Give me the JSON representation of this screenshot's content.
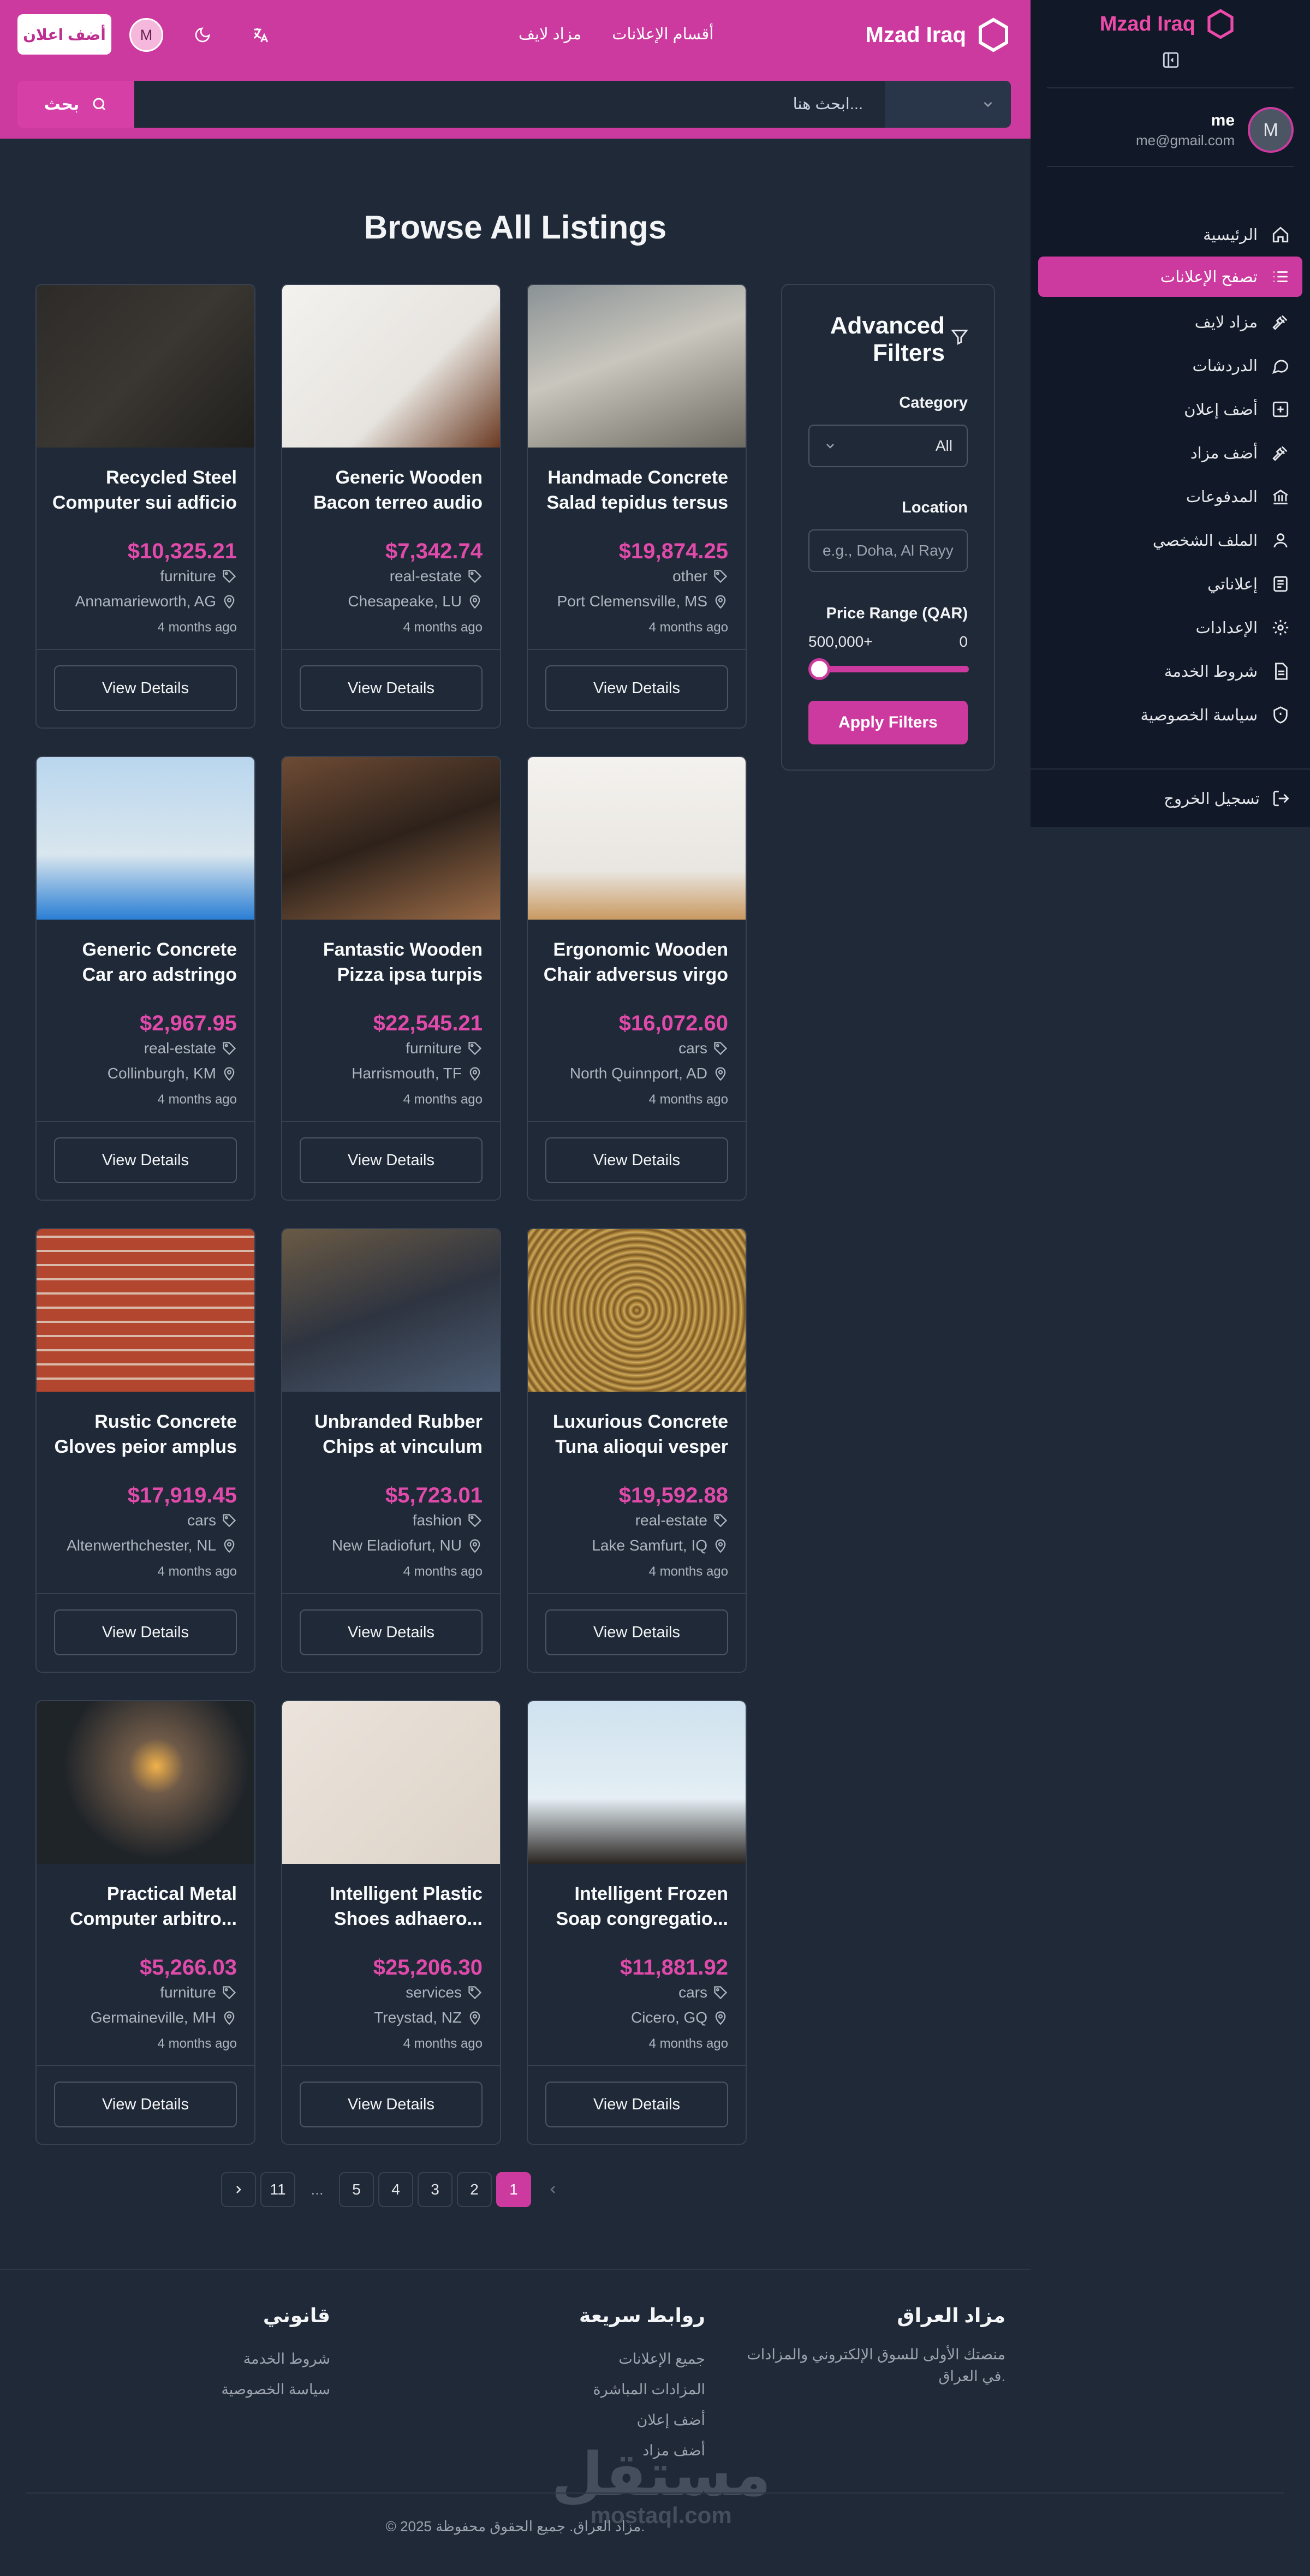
{
  "header": {
    "brand": "Mzad Iraq",
    "nav": [
      "أقسام الإعلانات",
      "مزاد لايف"
    ],
    "avatar_initial": "M",
    "add_button": "أضف اعلان"
  },
  "search": {
    "button_label": "بحث",
    "placeholder": "ابحث هنا...",
    "category_selected": ""
  },
  "sidebar": {
    "brand": "Mzad Iraq",
    "user": {
      "name": "me",
      "email": "me@gmail.com",
      "initial": "M"
    },
    "items": [
      {
        "label": "الرئيسية",
        "icon": "home-icon"
      },
      {
        "label": "تصفح الإعلانات",
        "icon": "list-icon",
        "active": true
      },
      {
        "label": "مزاد لايف",
        "icon": "gavel-icon"
      },
      {
        "label": "الدردشات",
        "icon": "chat-icon"
      },
      {
        "label": "أضف إعلان",
        "icon": "plus-square-icon"
      },
      {
        "label": "أضف مزاد",
        "icon": "gavel-icon"
      },
      {
        "label": "المدفوعات",
        "icon": "bank-icon"
      },
      {
        "label": "الملف الشخصي",
        "icon": "user-icon"
      },
      {
        "label": "إعلاناتي",
        "icon": "document-icon"
      },
      {
        "label": "الإعدادات",
        "icon": "gear-icon"
      },
      {
        "label": "شروط الخدمة",
        "icon": "file-text-icon"
      },
      {
        "label": "سياسة الخصوصية",
        "icon": "shield-icon"
      }
    ],
    "logout": "تسجيل الخروج"
  },
  "main": {
    "title": "Browse All Listings"
  },
  "listings": [
    {
      "title": "Handmade Concrete Salad tepidus tersus",
      "price": "$19,874.25",
      "category": "other",
      "location": "Port Clemensville, MS",
      "time": "4 months ago",
      "button": "View Details"
    },
    {
      "title": "Generic Wooden Bacon terreo audio",
      "price": "$7,342.74",
      "category": "real-estate",
      "location": "Chesapeake, LU",
      "time": "4 months ago",
      "button": "View Details"
    },
    {
      "title": "Recycled Steel Computer sui adficio",
      "price": "$10,325.21",
      "category": "furniture",
      "location": "Annamarieworth, AG",
      "time": "4 months ago",
      "button": "View Details"
    },
    {
      "title": "Ergonomic Wooden Chair adversus virgo",
      "price": "$16,072.60",
      "category": "cars",
      "location": "North Quinnport, AD",
      "time": "4 months ago",
      "button": "View Details"
    },
    {
      "title": "Fantastic Wooden Pizza ipsa turpis",
      "price": "$22,545.21",
      "category": "furniture",
      "location": "Harrismouth, TF",
      "time": "4 months ago",
      "button": "View Details"
    },
    {
      "title": "Generic Concrete Car aro adstringo",
      "price": "$2,967.95",
      "category": "real-estate",
      "location": "Collinburgh, KM",
      "time": "4 months ago",
      "button": "View Details"
    },
    {
      "title": "Luxurious Concrete Tuna alioqui vesper",
      "price": "$19,592.88",
      "category": "real-estate",
      "location": "Lake Samfurt, IQ",
      "time": "4 months ago",
      "button": "View Details"
    },
    {
      "title": "Unbranded Rubber Chips at vinculum",
      "price": "$5,723.01",
      "category": "fashion",
      "location": "New Eladiofurt, NU",
      "time": "4 months ago",
      "button": "View Details"
    },
    {
      "title": "Rustic Concrete Gloves peior amplus",
      "price": "$17,919.45",
      "category": "cars",
      "location": "Altenwerthchester, NL",
      "time": "4 months ago",
      "button": "View Details"
    },
    {
      "title": "Intelligent Frozen Soap congregatio...",
      "price": "$11,881.92",
      "category": "cars",
      "location": "Cicero, GQ",
      "time": "4 months ago",
      "button": "View Details"
    },
    {
      "title": "Intelligent Plastic Shoes adhaero...",
      "price": "$25,206.30",
      "category": "services",
      "location": "Treystad, NZ",
      "time": "4 months ago",
      "button": "View Details"
    },
    {
      "title": "Practical Metal Computer arbitro...",
      "price": "$5,266.03",
      "category": "furniture",
      "location": "Germaineville, MH",
      "time": "4 months ago",
      "button": "View Details"
    }
  ],
  "filters": {
    "title_line1": "Advanced",
    "title_line2": "Filters",
    "category_label": "Category",
    "category_value": "All",
    "location_label": "Location",
    "location_placeholder": "e.g., Doha, Al Rayyan",
    "price_label": "Price Range (QAR)",
    "price_min": "0",
    "price_max": "500,000+",
    "apply": "Apply Filters"
  },
  "pagination": {
    "pages": [
      "1",
      "2",
      "3",
      "4",
      "5"
    ],
    "ellipsis": "...",
    "last": "11",
    "current": "1"
  },
  "footer": {
    "about_title": "مزاد العراق",
    "about_text": "منصتك الأولى للسوق الإلكتروني والمزادات في العراق.",
    "links_title": "روابط سريعة",
    "links": [
      "جميع الإعلانات",
      "المزادات المباشرة",
      "أضف إعلان",
      "أضف مزاد"
    ],
    "legal_title": "قانوني",
    "legal": [
      "شروط الخدمة",
      "سياسة الخصوصية"
    ],
    "copyright": "© 2025 مزاد العراق. جميع الحقوق محفوظة.",
    "watermark_ar": "مستقل",
    "watermark_en": "mostaql.com"
  },
  "colors": {
    "accent": "#cd3a9f",
    "background": "#1f2937",
    "sidebar": "#111827"
  }
}
